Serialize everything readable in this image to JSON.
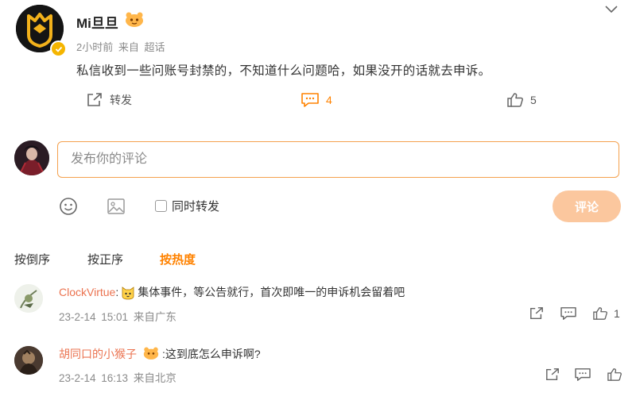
{
  "post": {
    "author": "Mi旦旦",
    "time": "2小时前",
    "source": "来自 超话",
    "text": "私信收到一些问账号封禁的，不知道什么问题哈，如果没开的话就去申诉。",
    "repost_label": "转发",
    "comment_count": "4",
    "like_count": "5"
  },
  "composer": {
    "placeholder": "发布你的评论",
    "repost_option": "同时转发",
    "submit_label": "评论"
  },
  "sort_tabs": [
    "按倒序",
    "按正序",
    "按热度"
  ],
  "comments": [
    {
      "user": "ClockVirtue",
      "separator": ":",
      "text": "集体事件，等公告就行，首次即唯一的申诉机会留着吧",
      "time": "23-2-14 15:01",
      "location": "来自广东",
      "like_count": "1"
    },
    {
      "user": "胡同口的小猴子",
      "separator": ":",
      "text": "这到底怎么申诉啊?",
      "time": "23-2-14 16:13",
      "location": "来自北京",
      "like_count": ""
    }
  ],
  "colors": {
    "accent": "#ff8200",
    "username": "#eb7350",
    "input_border": "#f4a14e",
    "submit_disabled": "#fbc79e",
    "verified": "#f5b500"
  },
  "icons": {
    "collapse": "chevron-down-icon",
    "repost": "share-icon",
    "comment": "comment-icon",
    "like": "thumbs-up-icon",
    "emoji": "smiley-icon",
    "image": "image-icon"
  }
}
